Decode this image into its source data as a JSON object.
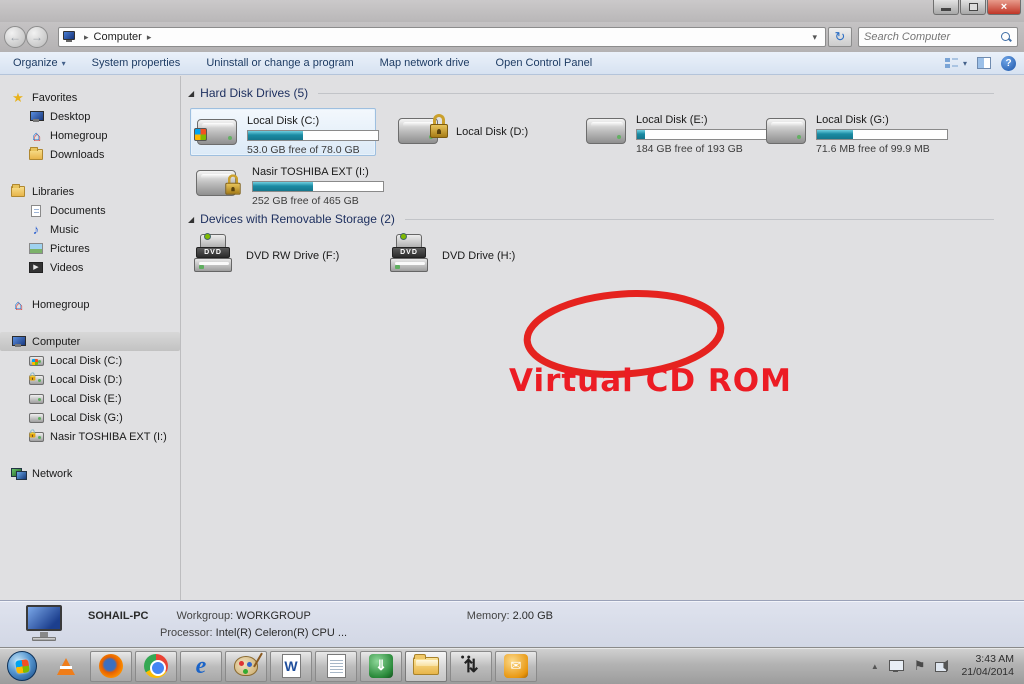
{
  "window": {
    "breadcrumb_root": "Computer",
    "search_placeholder": "Search Computer"
  },
  "icons": {
    "caret_down": "▾",
    "crumb_arrow": "▸",
    "back_arrow": "←",
    "forward_arrow": "→",
    "refresh": "↻",
    "section_triangle": "◢",
    "star": "★",
    "music_note": "♪",
    "play": "▶",
    "help_question": "?",
    "close_x": "×",
    "idm_arrow": "⇓",
    "people_arrows": "⇅",
    "envelope": "✉",
    "tray_up_arrow": "▲",
    "tray_flag": "⚑"
  },
  "toolbar": {
    "organize": "Organize",
    "items": [
      "System properties",
      "Uninstall or change a program",
      "Map network drive",
      "Open Control Panel"
    ]
  },
  "sidebar": {
    "items": [
      {
        "label": "Favorites"
      },
      {
        "label": "Desktop"
      },
      {
        "label": "Homegroup"
      },
      {
        "label": "Downloads"
      },
      {
        "label": "Libraries"
      },
      {
        "label": "Documents"
      },
      {
        "label": "Music"
      },
      {
        "label": "Pictures"
      },
      {
        "label": "Videos"
      },
      {
        "label": "Homegroup"
      },
      {
        "label": "Computer"
      },
      {
        "label": "Local Disk (C:)"
      },
      {
        "label": "Local Disk (D:)"
      },
      {
        "label": "Local Disk (E:)"
      },
      {
        "label": "Local Disk (G:)"
      },
      {
        "label": "Nasir TOSHIBA EXT (I:)"
      },
      {
        "label": "Network"
      }
    ]
  },
  "main": {
    "section1_title": "Hard Disk Drives (5)",
    "section2_title": "Devices with Removable Storage (2)",
    "drives": [
      {
        "name": "Local Disk (C:)",
        "free": "53.0 GB free of 78.0 GB",
        "used_pct": 42
      },
      {
        "name": "Local Disk (D:)"
      },
      {
        "name": "Local Disk (E:)",
        "free": "184 GB free of 193 GB",
        "used_pct": 6
      },
      {
        "name": "Local Disk (G:)",
        "free": "71.6 MB free of 99.9 MB",
        "used_pct": 28
      },
      {
        "name": "Nasir TOSHIBA EXT (I:)",
        "free": "252 GB free of 465 GB",
        "used_pct": 46
      }
    ],
    "removable": [
      {
        "name": "DVD RW Drive (F:)"
      },
      {
        "name": "DVD Drive (H:)"
      }
    ],
    "annotation_text": "Virtual CD ROM",
    "annotation_color": "#ec1c24",
    "dvd_badge": "DVD"
  },
  "details": {
    "computer_name": "SOHAIL-PC",
    "workgroup_label": "Workgroup:",
    "workgroup_value": "WORKGROUP",
    "memory_label": "Memory:",
    "memory_value": "2.00 GB",
    "processor_label": "Processor:",
    "processor_value": "Intel(R) Celeron(R) CPU ..."
  },
  "taskbar": {
    "icons": [
      "start",
      "vlc",
      "firefox",
      "chrome",
      "internet-explorer",
      "paint",
      "word",
      "notepad",
      "idm",
      "explorer-folder",
      "people-transfer",
      "outlook"
    ],
    "word_letter": "W"
  },
  "tray": {
    "time": "3:43 AM",
    "date": "21/04/2014"
  }
}
